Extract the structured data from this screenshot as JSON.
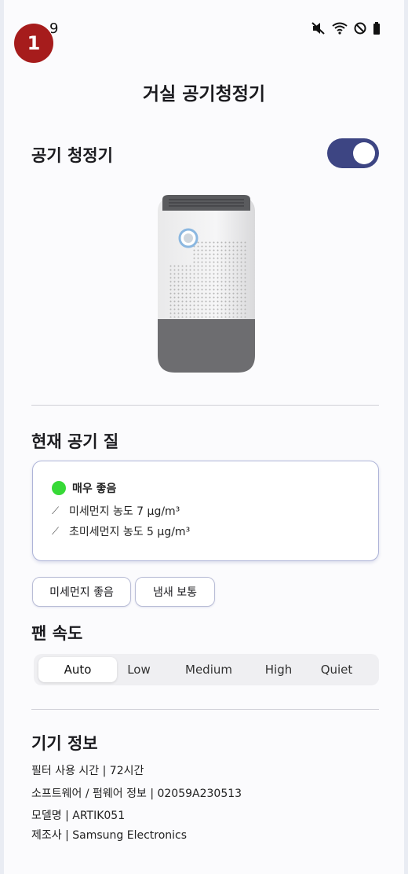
{
  "status": {
    "time": "9",
    "badge": "1"
  },
  "header": {
    "title": "거실 공기청정기"
  },
  "purifier": {
    "section_title": "공기 청정기",
    "power_on": true
  },
  "air_quality": {
    "section_title": "현재 공기 질",
    "status": "매우 좋음",
    "status_color": "#37d937",
    "pm10": "미세먼지 농도 7 μg/m³",
    "pm25": "초미세먼지 농도 5 μg/m³",
    "chips": [
      "미세먼지 좋음",
      "냄새 보통"
    ]
  },
  "fan": {
    "section_title": "팬 속도",
    "options": [
      "Auto",
      "Low",
      "Medium",
      "High",
      "Quiet"
    ],
    "selected": "Auto"
  },
  "device_info": {
    "section_title": "기기 정보",
    "lines": [
      "필터 사용 시간 | 72시간",
      "소프트웨어 / 펌웨어 정보 | 02059A230513",
      "모델명 | ARTIK051",
      "제조사 | Samsung Electronics"
    ]
  },
  "colors": {
    "accent": "#3d4583",
    "badge": "#a61c1c"
  }
}
